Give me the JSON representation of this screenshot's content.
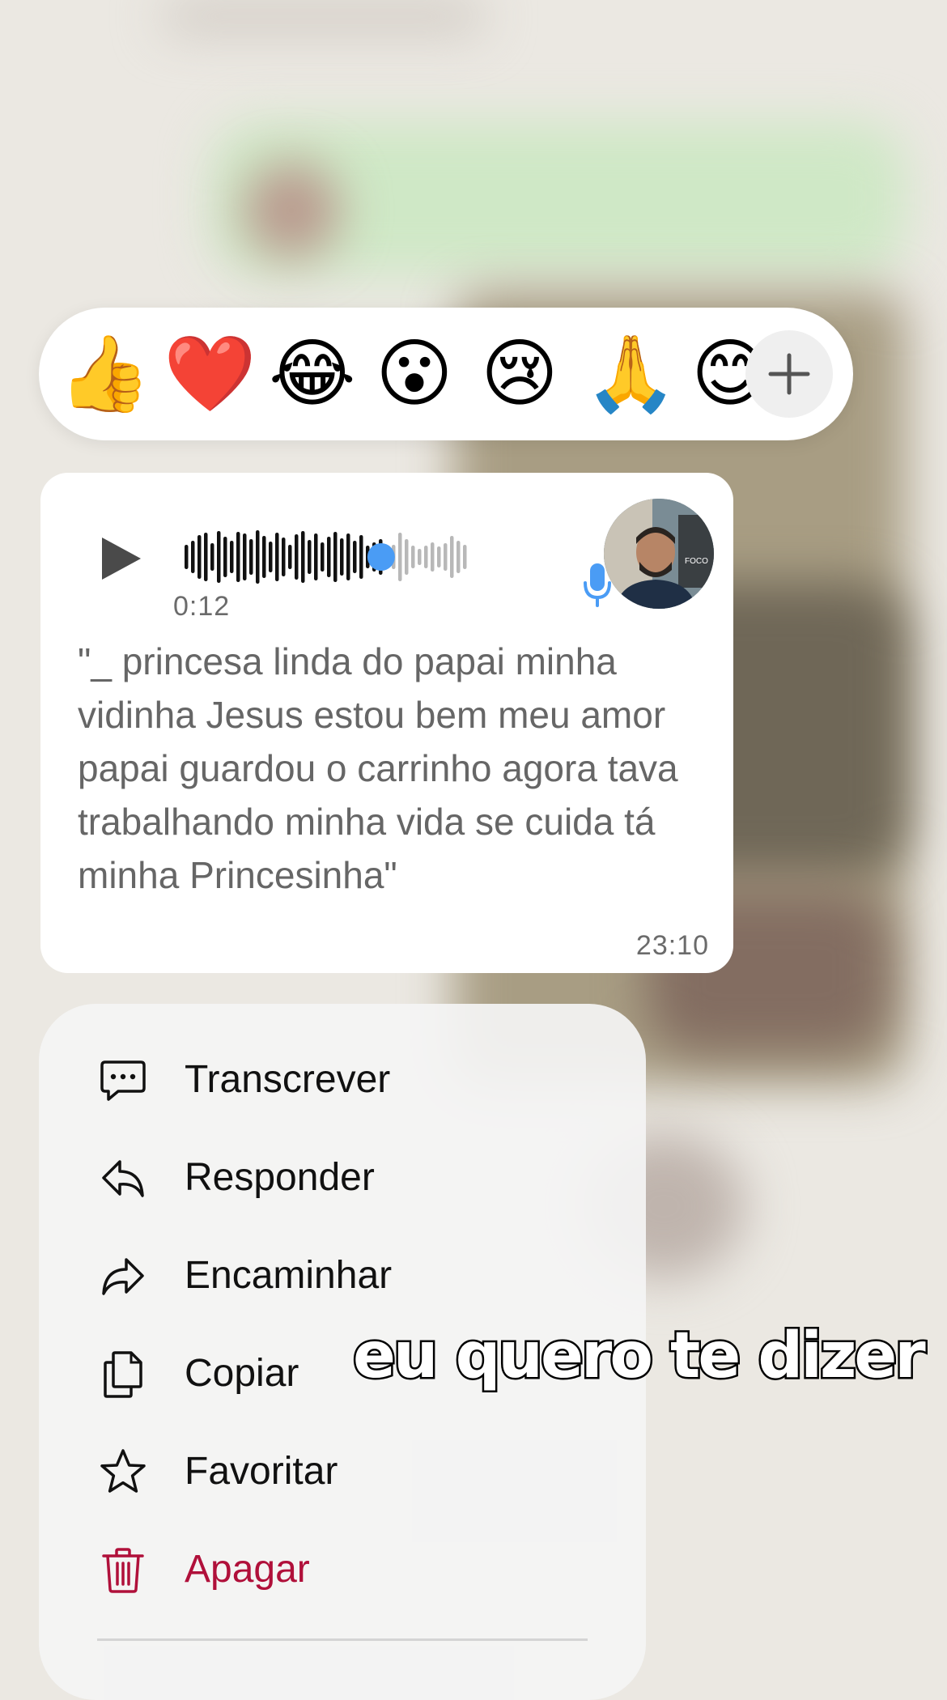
{
  "reactions": {
    "emojis": [
      {
        "name": "thumbs-up-emoji",
        "glyph": "👍"
      },
      {
        "name": "heart-emoji",
        "glyph": "❤️"
      },
      {
        "name": "laughing-emoji",
        "glyph": "😂"
      },
      {
        "name": "surprised-emoji",
        "glyph": "😮"
      },
      {
        "name": "sad-emoji",
        "glyph": "😢"
      },
      {
        "name": "praying-hands-emoji",
        "glyph": "🙏"
      },
      {
        "name": "smile-emoji",
        "glyph": "😊"
      }
    ],
    "more_icon": "plus-icon"
  },
  "voice_message": {
    "duration": "0:12",
    "progress": 0.69,
    "transcript": "\"_ princesa linda do papai minha vidinha Jesus estou bem meu amor papai guardou o carrinho agora tava trabalhando minha vida se cuida tá minha Princesinha\"",
    "time": "23:10",
    "accent_color": "#4a9cf5"
  },
  "menu": {
    "items": [
      {
        "label": "Transcrever",
        "icon": "transcribe-icon"
      },
      {
        "label": "Responder",
        "icon": "reply-icon"
      },
      {
        "label": "Encaminhar",
        "icon": "forward-icon"
      },
      {
        "label": "Copiar",
        "icon": "copy-icon"
      },
      {
        "label": "Favoritar",
        "icon": "star-icon"
      },
      {
        "label": "Apagar",
        "icon": "trash-icon",
        "danger": true
      }
    ],
    "danger_color": "#b0103a"
  },
  "caption": "eu quero te dizer"
}
